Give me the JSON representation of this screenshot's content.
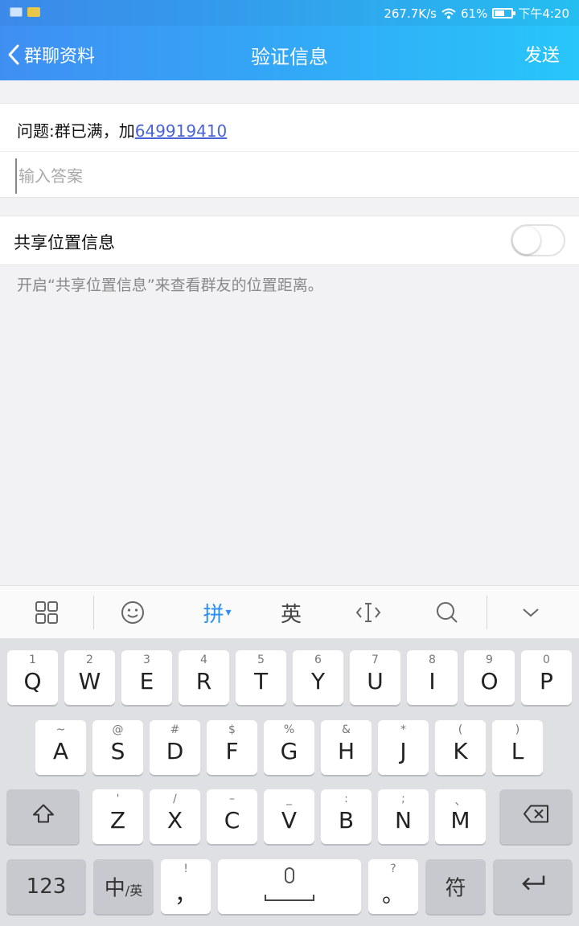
{
  "status_bar": {
    "net_speed": "267.7K/s",
    "battery": "61%",
    "battery_level": 0.61,
    "time": "下午4:20",
    "left_icons": [
      "keyboard-icon",
      "notification-badge-icon"
    ]
  },
  "nav": {
    "back_label": "群聊资料",
    "title": "验证信息",
    "send_label": "发送"
  },
  "question": {
    "prefix": "问题:群已满，加",
    "link_number": "649919410"
  },
  "answer": {
    "placeholder": "输入答案",
    "value": ""
  },
  "location": {
    "label": "共享位置信息",
    "enabled": false,
    "hint": "开启“共享位置信息”来查看群友的位置距离。"
  },
  "keyboard_toolbar": {
    "items": [
      "grid-icon",
      "emoji-icon",
      "拼",
      "英",
      "cursor-icon",
      "search-icon",
      "collapse-icon"
    ],
    "pinyin_label": "拼",
    "english_label": "英"
  },
  "keyboard": {
    "row1": [
      {
        "main": "Q",
        "sub": "1"
      },
      {
        "main": "W",
        "sub": "2"
      },
      {
        "main": "E",
        "sub": "3"
      },
      {
        "main": "R",
        "sub": "4"
      },
      {
        "main": "T",
        "sub": "5"
      },
      {
        "main": "Y",
        "sub": "6"
      },
      {
        "main": "U",
        "sub": "7"
      },
      {
        "main": "I",
        "sub": "8"
      },
      {
        "main": "O",
        "sub": "9"
      },
      {
        "main": "P",
        "sub": "0"
      }
    ],
    "row2": [
      {
        "main": "A",
        "sub": "~"
      },
      {
        "main": "S",
        "sub": "@"
      },
      {
        "main": "D",
        "sub": "#"
      },
      {
        "main": "F",
        "sub": "$"
      },
      {
        "main": "G",
        "sub": "%"
      },
      {
        "main": "H",
        "sub": "&"
      },
      {
        "main": "J",
        "sub": "*"
      },
      {
        "main": "K",
        "sub": "("
      },
      {
        "main": "L",
        "sub": ")"
      }
    ],
    "row3": [
      {
        "main": "Z",
        "sub": "'"
      },
      {
        "main": "X",
        "sub": "/"
      },
      {
        "main": "C",
        "sub": "–"
      },
      {
        "main": "V",
        "sub": "_"
      },
      {
        "main": "B",
        "sub": ":"
      },
      {
        "main": "N",
        "sub": ";"
      },
      {
        "main": "M",
        "sub": "、"
      }
    ],
    "num_label": "123",
    "lang_main": "中",
    "lang_sub": "/英",
    "comma_main": "，",
    "comma_sub": "!",
    "period_main": "。",
    "period_sub": "?",
    "symbol_label": "符"
  }
}
